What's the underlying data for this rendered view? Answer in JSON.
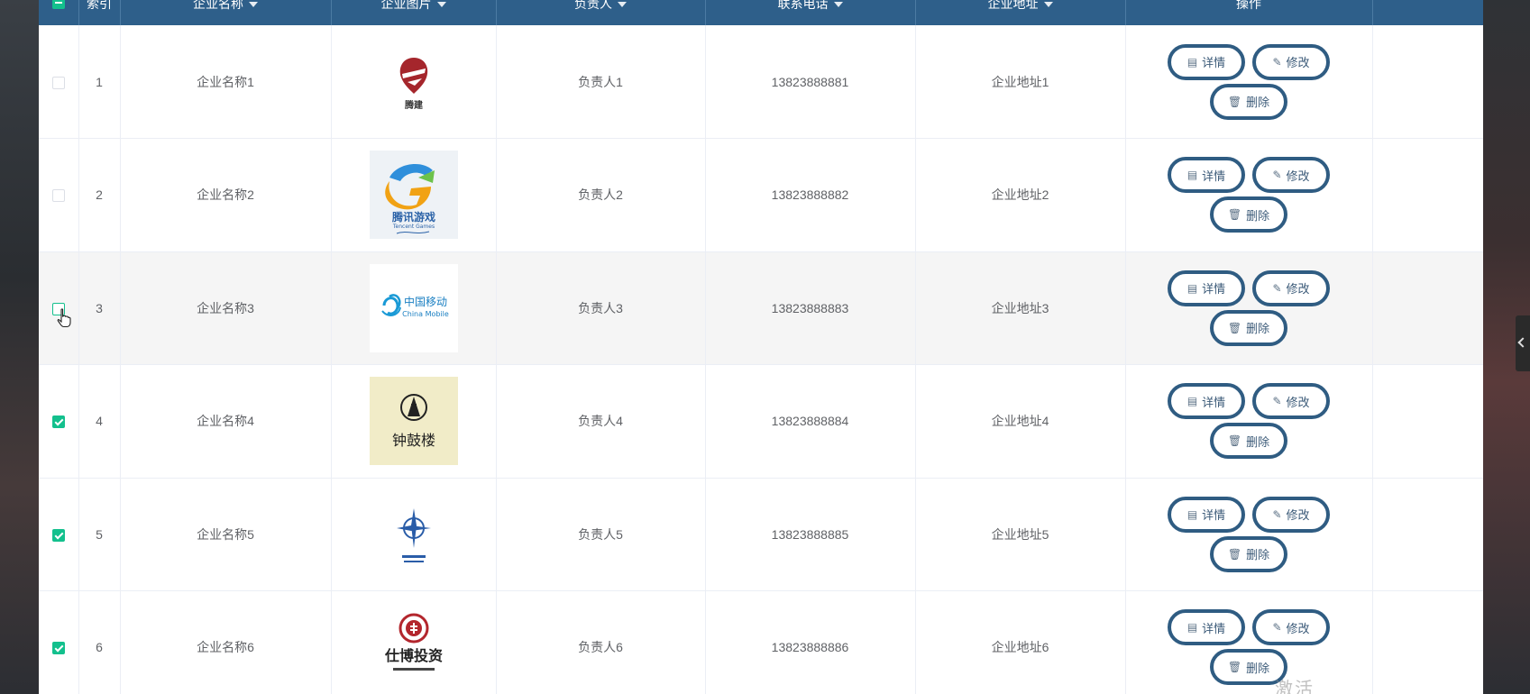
{
  "table": {
    "headers": {
      "index": "索引",
      "name": "企业名称",
      "image": "企业图片",
      "manager": "负责人",
      "phone": "联系电话",
      "address": "企业地址",
      "actions": "操作"
    },
    "buttons": {
      "detail": "详情",
      "edit": "修改",
      "delete": "删除"
    },
    "rows": [
      {
        "index": "1",
        "name": "企业名称1",
        "logo": "tengjian-logo",
        "manager": "负责人1",
        "phone": "13823888881",
        "address": "企业地址1",
        "checked": false
      },
      {
        "index": "2",
        "name": "企业名称2",
        "logo": "tencent-games-logo",
        "manager": "负责人2",
        "phone": "13823888882",
        "address": "企业地址2",
        "checked": false
      },
      {
        "index": "3",
        "name": "企业名称3",
        "logo": "china-mobile-logo",
        "manager": "负责人3",
        "phone": "13823888883",
        "address": "企业地址3",
        "checked": false
      },
      {
        "index": "4",
        "name": "企业名称4",
        "logo": "zhonggulou-logo",
        "manager": "负责人4",
        "phone": "13823888884",
        "address": "企业地址4",
        "checked": true
      },
      {
        "index": "5",
        "name": "企业名称5",
        "logo": "compass-logo",
        "manager": "负责人5",
        "phone": "13823888885",
        "address": "企业地址5",
        "checked": true
      },
      {
        "index": "6",
        "name": "企业名称6",
        "logo": "shibo-investment-logo",
        "manager": "负责人6",
        "phone": "13823888886",
        "address": "企业地址6",
        "checked": true
      }
    ]
  },
  "logos": {
    "r1_text": "腾建",
    "r2_text": "腾讯游戏",
    "r2_sub": "Tencent Games",
    "r3_text": "中国移动",
    "r3_sub": "China Mobile",
    "r4_text": "钟鼓楼",
    "r6_text": "仕博投资"
  },
  "colors": {
    "header_bg": "#2e5f8a",
    "checkbox_green": "#13c08d",
    "button_border": "#2f5c82"
  },
  "watermark": "激活"
}
